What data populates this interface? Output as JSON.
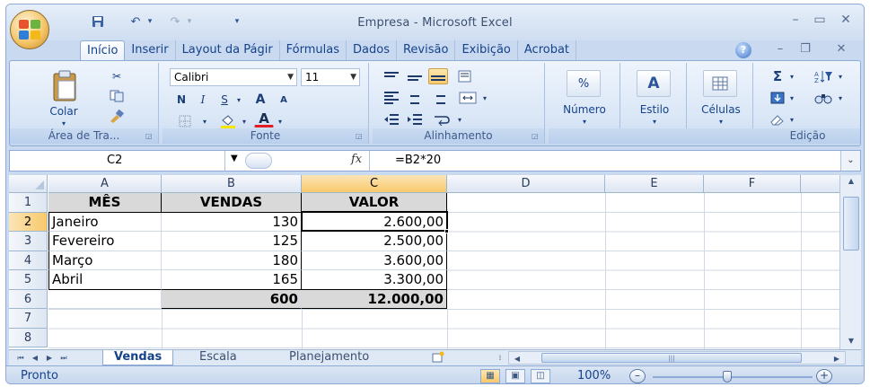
{
  "window": {
    "title": "Empresa - Microsoft Excel",
    "controls": {
      "minimize": "–",
      "maximize": "▭",
      "close": "✕"
    },
    "doc_controls": {
      "minimize": "–",
      "restore": "❐",
      "close": "✕"
    }
  },
  "qat": {
    "save_icon": "save-icon",
    "undo": "↶",
    "redo": "↷",
    "customize": "▾"
  },
  "tabs": [
    {
      "label": "Início",
      "active": true
    },
    {
      "label": "Inserir"
    },
    {
      "label": "Layout da Págir"
    },
    {
      "label": "Fórmulas"
    },
    {
      "label": "Dados"
    },
    {
      "label": "Revisão"
    },
    {
      "label": "Exibição"
    },
    {
      "label": "Acrobat"
    }
  ],
  "ribbon": {
    "clipboard": {
      "label": "Área de Tra...",
      "paste": "Colar"
    },
    "font": {
      "label": "Fonte",
      "name": "Calibri",
      "size": "11",
      "bold": "N",
      "italic": "I",
      "underline": "S",
      "grow": "A",
      "shrink": "A",
      "font_color_letter": "A"
    },
    "alignment": {
      "label": "Alinhamento"
    },
    "number": {
      "label": "Número",
      "percent": "%"
    },
    "style": {
      "label": "Estilo",
      "letter": "A"
    },
    "cells": {
      "label": "Células"
    },
    "editing": {
      "label": "Edição",
      "sum": "Σ"
    }
  },
  "formula_bar": {
    "name_box": "C2",
    "fx": "fx",
    "formula": "=B2*20"
  },
  "columns": [
    "A",
    "B",
    "C",
    "D",
    "E",
    "F"
  ],
  "rows": [
    "1",
    "2",
    "3",
    "4",
    "5",
    "6",
    "7",
    "8"
  ],
  "table": {
    "headers": [
      "MÊS",
      "VENDAS",
      "VALOR"
    ],
    "data": [
      [
        "Janeiro",
        "130",
        "2.600,00"
      ],
      [
        "Fevereiro",
        "125",
        "2.500,00"
      ],
      [
        "Março",
        "180",
        "3.600,00"
      ],
      [
        "Abril",
        "165",
        "3.300,00"
      ]
    ],
    "totals": [
      "",
      "600",
      "12.000,00"
    ]
  },
  "active_cell": "C2",
  "sheets": [
    {
      "label": "Vendas",
      "active": true
    },
    {
      "label": "Escala"
    },
    {
      "label": "Planejamento"
    }
  ],
  "status": {
    "text": "Pronto",
    "zoom": "100%"
  },
  "colors": {
    "header_fill": "#d9d9d9",
    "selected_header": "#f8c96b",
    "ribbon_text": "#15428b"
  }
}
